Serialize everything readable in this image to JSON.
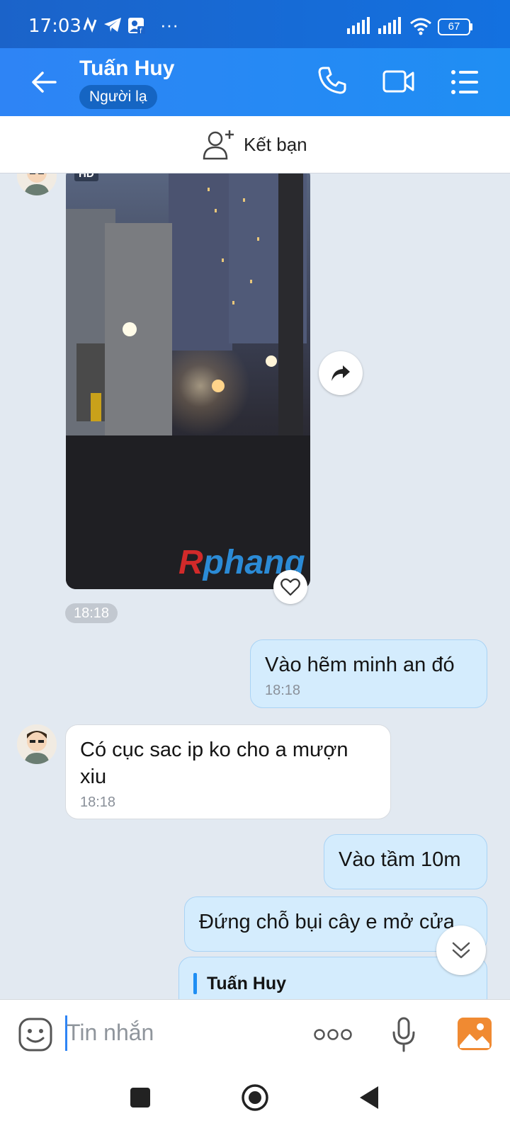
{
  "status_bar": {
    "time": "17:03",
    "battery": "67",
    "icons": [
      "n-icon",
      "telegram-icon",
      "facebook-contact-icon",
      "more-dots-icon",
      "signal-icon",
      "signal-icon",
      "wifi-icon",
      "battery-icon"
    ]
  },
  "header": {
    "title": "Tuấn Huy",
    "badge": "Người lạ"
  },
  "friend_bar": {
    "label": "Kết bạn"
  },
  "messages": {
    "video": {
      "hd_label": "HD",
      "watermark": "Rphang",
      "time": "18:18"
    },
    "m1": {
      "text": "Vào hẽm minh an đó",
      "time": "18:18"
    },
    "m2": {
      "text": "Có cục sac ip ko cho a mượn xiu",
      "time": "18:18"
    },
    "m3": {
      "text": "Vào tầm 10m"
    },
    "m4": {
      "text": "Đứng chỗ bụi cây e mở cửa"
    },
    "m5": {
      "reply_name": "Tuấn Huy"
    }
  },
  "input": {
    "placeholder": "Tin nhắn"
  },
  "colors": {
    "header": "#1f8ef3",
    "outgoing_bubble": "#d4ecfd",
    "chat_bg": "#e2e9f1"
  }
}
